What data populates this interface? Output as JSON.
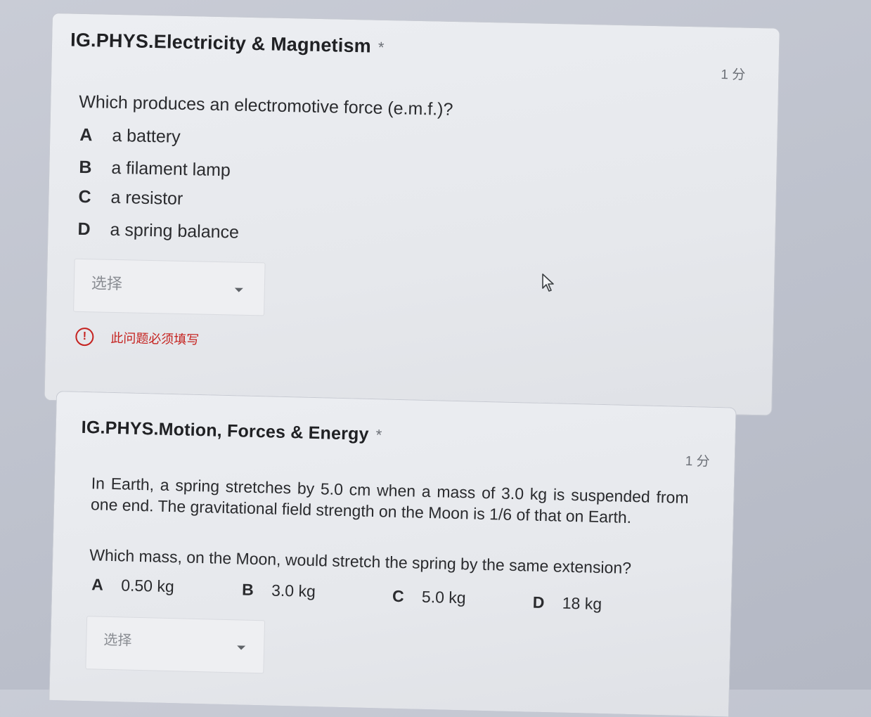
{
  "question1": {
    "title": "IG.PHYS.Electricity & Magnetism",
    "required_marker": "*",
    "points": "1 分",
    "text": "Which produces an electromotive force (e.m.f.)?",
    "options": [
      {
        "letter": "A",
        "text": "a battery"
      },
      {
        "letter": "B",
        "text": "a filament lamp"
      },
      {
        "letter": "C",
        "text": "a resistor"
      },
      {
        "letter": "D",
        "text": "a spring balance"
      }
    ],
    "select_placeholder": "选择",
    "error_text": "此问题必须填写",
    "error_icon_glyph": "!"
  },
  "question2": {
    "title": "IG.PHYS.Motion, Forces & Energy",
    "required_marker": "*",
    "points": "1 分",
    "text": "In Earth, a spring stretches by 5.0 cm when a mass of 3.0 kg is suspended from one end. The gravitational field strength on the Moon is 1/6 of that on Earth.",
    "question": "Which mass, on the Moon, would stretch the spring by the same extension?",
    "options": [
      {
        "letter": "A",
        "text": "0.50 kg"
      },
      {
        "letter": "B",
        "text": "3.0 kg"
      },
      {
        "letter": "C",
        "text": "5.0 kg"
      },
      {
        "letter": "D",
        "text": "18 kg"
      }
    ],
    "select_placeholder": "选择"
  },
  "icons": {
    "dropdown": "chevron-down-icon",
    "error": "error-icon",
    "cursor": "mouse-pointer-icon"
  },
  "colors": {
    "error": "#c5221f",
    "muted": "#6b6f76"
  }
}
